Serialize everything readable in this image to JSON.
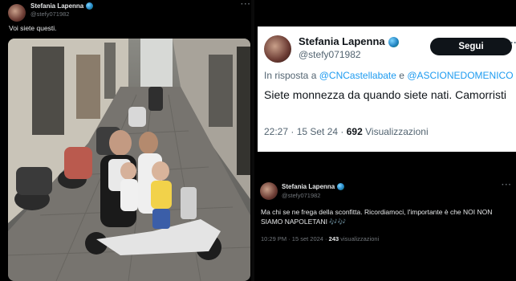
{
  "left_tweet": {
    "name": "Stefania Lapenna",
    "handle": "@stefy071982",
    "text": "Voi siete questi.",
    "more_label": "···",
    "photo_icon": "street-scooter-photo"
  },
  "quoted_card": {
    "name": "Stefania Lapenna",
    "handle": "@stefy071982",
    "follow_label": "Segui",
    "more_label": "···",
    "reply_prefix": "In risposta a",
    "reply_mention_1": "@CNCastellabate",
    "reply_joiner": "e",
    "reply_mention_2": "@ASCIONEDOMENICO",
    "text": "Siete monnezza da quando siete nati. Camorristi",
    "time": "22:27 · 15 Set 24 ·",
    "views_count": "692",
    "views_label": "Visualizzazioni"
  },
  "right_tweet": {
    "name": "Stefania Lapenna",
    "handle": "@stefy071982",
    "more_label": "···",
    "text": "Ma chi se ne frega della sconfitta. Ricordiamoci, l'importante è che NOI NON SIAMO NAPOLETANI 🎶🎶",
    "time": "10:29 PM · 15 set 2024 ·",
    "views_count": "243",
    "views_label": "visualizzazioni"
  },
  "colors": {
    "background": "#000000",
    "text": "#e7e9ea",
    "muted": "#71767b",
    "link": "#1d9bf0",
    "card_bg": "#ffffff"
  }
}
